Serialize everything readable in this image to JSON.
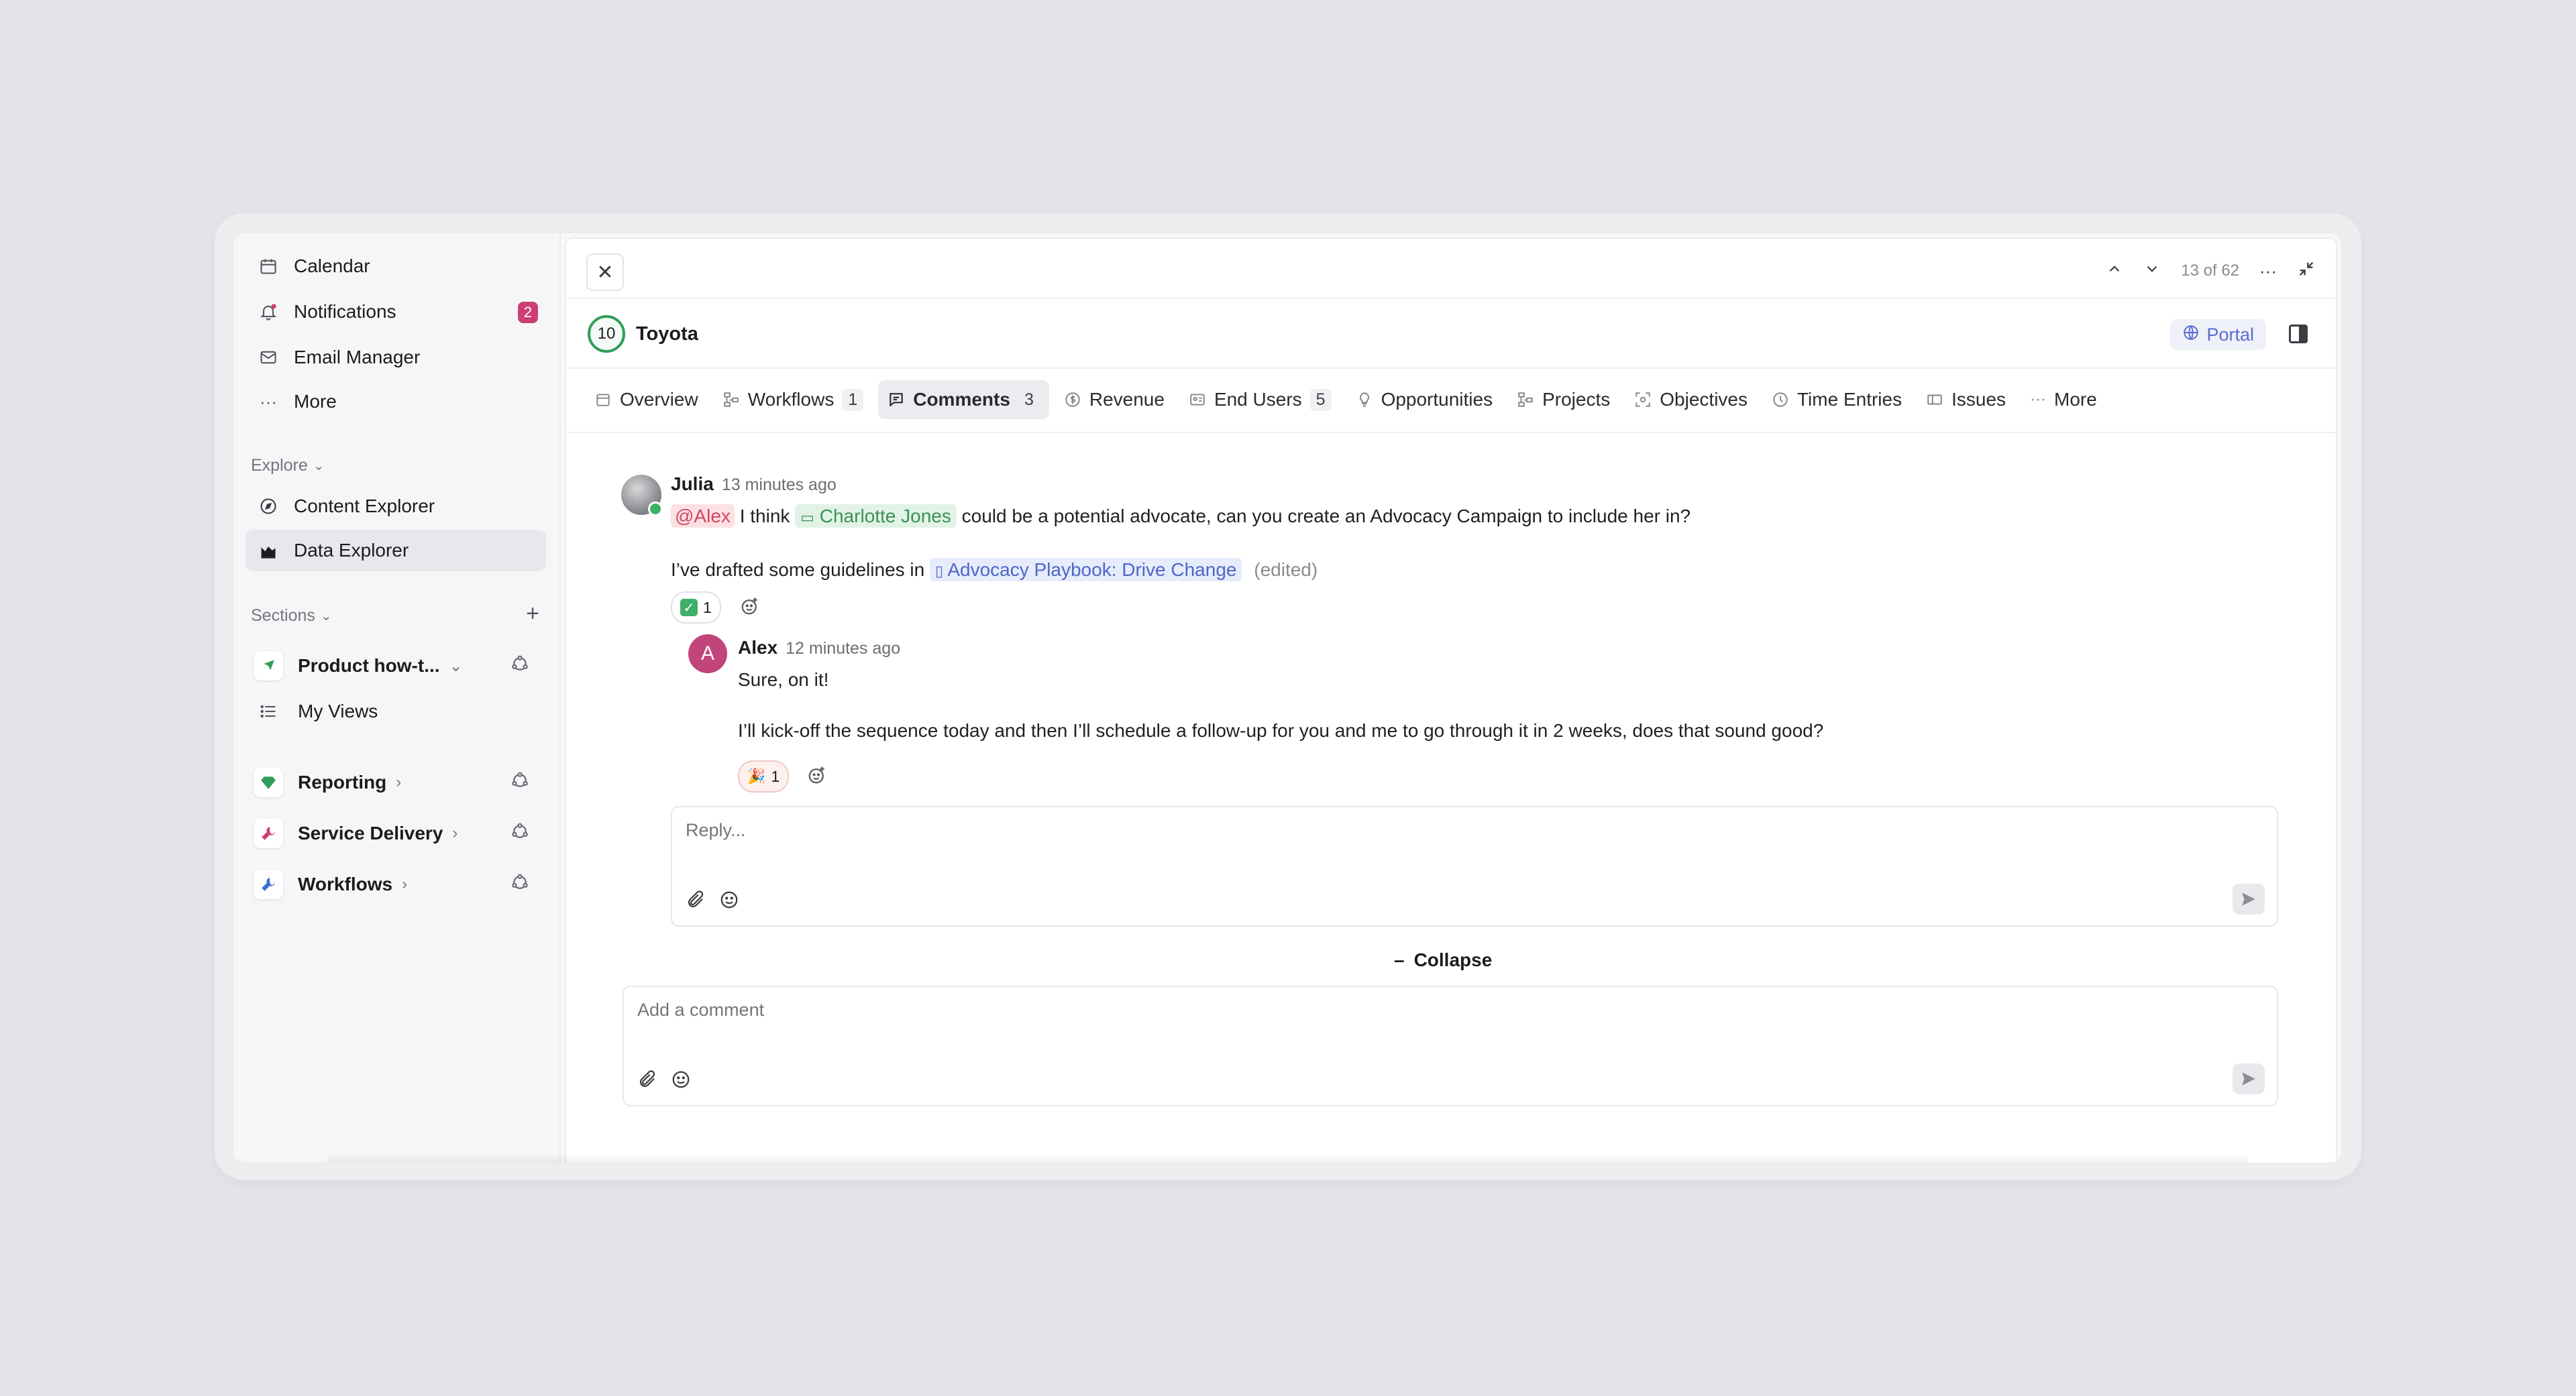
{
  "sidebar": {
    "top_items": [
      {
        "label": "Calendar",
        "icon": "calendar-icon"
      },
      {
        "label": "Notifications",
        "icon": "bell-icon",
        "badge": "2"
      },
      {
        "label": "Email Manager",
        "icon": "mail-icon"
      },
      {
        "label": "More",
        "icon": "more-icon"
      }
    ],
    "explore_label": "Explore",
    "explore_items": [
      {
        "label": "Content Explorer",
        "icon": "compass-icon"
      },
      {
        "label": "Data Explorer",
        "icon": "chart-area-icon",
        "active": true
      }
    ],
    "sections_label": "Sections",
    "sections": [
      {
        "label": "Product how-t...",
        "icon": "rocket-icon",
        "color": "#2f9e57"
      },
      {
        "label": "My Views",
        "icon": "list-icon"
      },
      {
        "label": "Reporting",
        "icon": "gem-icon",
        "color": "#2f9e57"
      },
      {
        "label": "Service Delivery",
        "icon": "wrench-icon",
        "color": "#cc3f73"
      },
      {
        "label": "Workflows",
        "icon": "wrench-icon",
        "color": "#3a6fd8"
      }
    ]
  },
  "header": {
    "counter": "13 of 62",
    "score": "10",
    "record_name": "Toyota",
    "portal_label": "Portal"
  },
  "tabs": [
    {
      "label": "Overview",
      "icon": "calendar-icon"
    },
    {
      "label": "Workflows",
      "icon": "workflow-icon",
      "count": "1"
    },
    {
      "label": "Comments",
      "icon": "comment-icon",
      "count": "3",
      "active": true
    },
    {
      "label": "Revenue",
      "icon": "dollar-icon"
    },
    {
      "label": "End Users",
      "icon": "id-card-icon",
      "count": "5"
    },
    {
      "label": "Opportunities",
      "icon": "lightbulb-icon"
    },
    {
      "label": "Projects",
      "icon": "workflow-icon"
    },
    {
      "label": "Objectives",
      "icon": "target-icon"
    },
    {
      "label": "Time Entries",
      "icon": "clock-icon"
    },
    {
      "label": "Issues",
      "icon": "ticket-icon"
    },
    {
      "label": "More",
      "icon": "more-icon"
    }
  ],
  "comments": {
    "first": {
      "author": "Julia",
      "time": "13 minutes ago",
      "mention": "@Alex",
      "text1": "I think",
      "contact": "Charlotte Jones",
      "text2": "could be a potential advocate, can you create an Advocacy Campaign to include her in?",
      "text3": "I’ve drafted some guidelines in",
      "doc": "Advocacy Playbook: Drive Change",
      "edited": "(edited)",
      "reaction_count": "1"
    },
    "reply": {
      "author": "Alex",
      "initial": "A",
      "time": "12 minutes ago",
      "line1": "Sure, on it!",
      "line2": "I’ll kick-off the sequence today and then I’ll schedule a follow-up for you and me to go through it in 2 weeks, does that sound good?",
      "reaction_count": "1"
    },
    "reply_placeholder": "Reply...",
    "collapse_label": "Collapse",
    "comment_placeholder": "Add a comment"
  },
  "colors": {
    "accent": "#5b6bd0",
    "badge": "#cc3f73",
    "score_ring": "#2f9e57"
  }
}
